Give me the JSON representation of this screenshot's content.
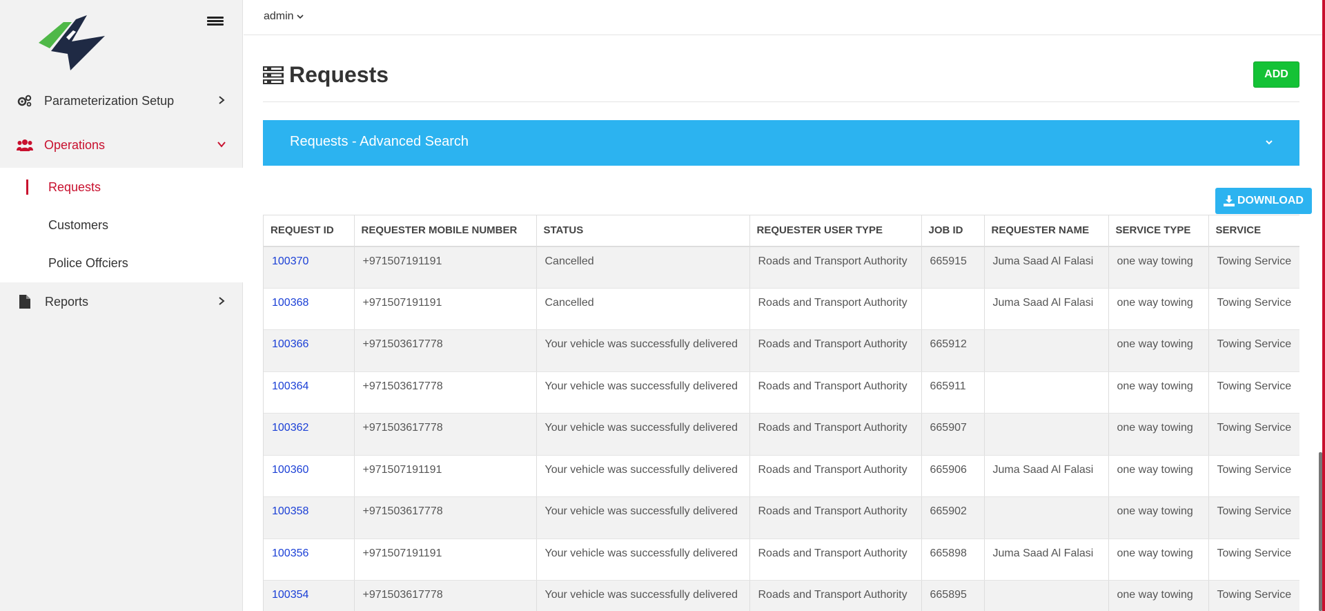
{
  "sidebar": {
    "items": [
      {
        "label": "Parameterization Setup",
        "icon": "gears-icon"
      },
      {
        "label": "Operations",
        "icon": "users-icon"
      },
      {
        "label": "Reports",
        "icon": "file-icon"
      }
    ],
    "submenu": [
      {
        "label": "Requests"
      },
      {
        "label": "Customers"
      },
      {
        "label": "Police Offciers"
      }
    ]
  },
  "topbar": {
    "user": "admin"
  },
  "page": {
    "title": "Requests",
    "add_label": "ADD",
    "advanced_search": "Requests - Advanced Search",
    "download_label": "DOWNLOAD"
  },
  "table": {
    "headers": [
      "REQUEST ID",
      "REQUESTER MOBILE NUMBER",
      "STATUS",
      "REQUESTER USER TYPE",
      "JOB ID",
      "REQUESTER NAME",
      "SERVICE TYPE",
      "SERVICE"
    ],
    "rows": [
      [
        "100370",
        "+971507191191",
        "Cancelled",
        "Roads and Transport Authority",
        "665915",
        "Juma Saad Al Falasi",
        "one way towing",
        "Towing Service"
      ],
      [
        "100368",
        "+971507191191",
        "Cancelled",
        "Roads and Transport Authority",
        "",
        "Juma Saad Al Falasi",
        "one way towing",
        "Towing Service"
      ],
      [
        "100366",
        "+971503617778",
        "Your vehicle was successfully delivered",
        "Roads and Transport Authority",
        "665912",
        "",
        "one way towing",
        "Towing Service"
      ],
      [
        "100364",
        "+971503617778",
        "Your vehicle was successfully delivered",
        "Roads and Transport Authority",
        "665911",
        "",
        "one way towing",
        "Towing Service"
      ],
      [
        "100362",
        "+971503617778",
        "Your vehicle was successfully delivered",
        "Roads and Transport Authority",
        "665907",
        "",
        "one way towing",
        "Towing Service"
      ],
      [
        "100360",
        "+971507191191",
        "Your vehicle was successfully delivered",
        "Roads and Transport Authority",
        "665906",
        "Juma Saad Al Falasi",
        "one way towing",
        "Towing Service"
      ],
      [
        "100358",
        "+971503617778",
        "Your vehicle was successfully delivered",
        "Roads and Transport Authority",
        "665902",
        "",
        "one way towing",
        "Towing Service"
      ],
      [
        "100356",
        "+971507191191",
        "Your vehicle was successfully delivered",
        "Roads and Transport Authority",
        "665898",
        "Juma Saad Al Falasi",
        "one way towing",
        "Towing Service"
      ],
      [
        "100354",
        "+971503617778",
        "Your vehicle was successfully delivered",
        "Roads and Transport Authority",
        "665895",
        "",
        "one way towing",
        "Towing Service"
      ]
    ]
  },
  "colors": {
    "accent_red": "#c8102e",
    "add_green": "#14c236",
    "panel_blue": "#2cb3f0",
    "link_blue": "#1a3fd6"
  }
}
